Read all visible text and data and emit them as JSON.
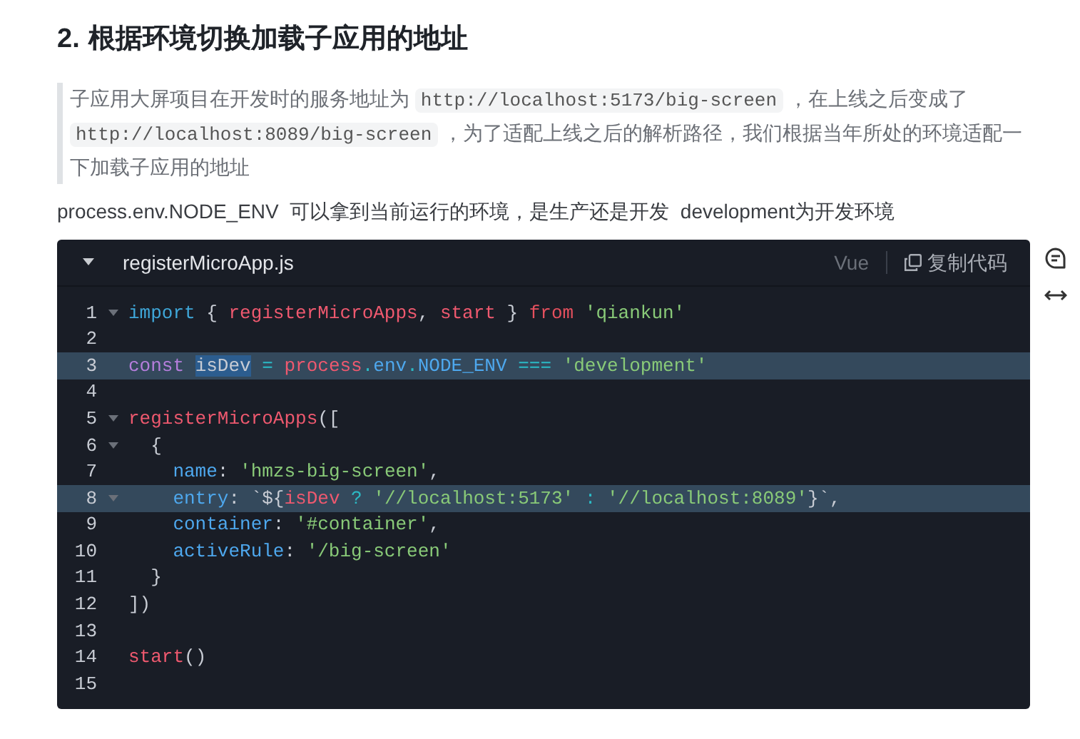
{
  "heading": {
    "number": "2.",
    "text": "根据环境切换加载子应用的地址"
  },
  "quote": {
    "segments": [
      {
        "kind": "text",
        "text": "子应用大屏项目在开发时的服务地址为 "
      },
      {
        "kind": "code",
        "text": "http://localhost:5173/big-screen"
      },
      {
        "kind": "text",
        "text": " ，在上线之后变成了 "
      },
      {
        "kind": "code",
        "text": "http://localhost:8089/big-screen"
      },
      {
        "kind": "text",
        "text": " ，为了适配上线之后的解析路径，我们根据当年所处的环境适配一下加载子应用的地址"
      }
    ]
  },
  "paragraph": "process.env.NODE_ENV  可以拿到当前运行的环境，是生产还是开发  development为开发环境",
  "code_block": {
    "filename": "registerMicroApp.js",
    "expanded": true,
    "language": "Vue",
    "copy_label": "复制代码",
    "lines": [
      {
        "number": "1",
        "foldable": true,
        "highlighted": false,
        "tokens": [
          {
            "kind": "kw",
            "text": "import"
          },
          {
            "kind": "plain",
            "text": " { "
          },
          {
            "kind": "fn",
            "text": "registerMicroApps"
          },
          {
            "kind": "plain",
            "text": ", "
          },
          {
            "kind": "fn",
            "text": "start"
          },
          {
            "kind": "plain",
            "text": " } "
          },
          {
            "kind": "from",
            "text": "from"
          },
          {
            "kind": "str",
            "text": " 'qiankun'"
          }
        ]
      },
      {
        "number": "2",
        "foldable": false,
        "highlighted": false
      },
      {
        "number": "3",
        "foldable": false,
        "highlighted": true,
        "tokens": [
          {
            "kind": "decl",
            "text": "const "
          },
          {
            "kind": "plain",
            "text": "isDev",
            "selected": true
          },
          {
            "kind": "op",
            "text": " = "
          },
          {
            "kind": "fn",
            "text": "process"
          },
          {
            "kind": "op",
            "text": "."
          },
          {
            "kind": "prop",
            "text": "env"
          },
          {
            "kind": "op",
            "text": "."
          },
          {
            "kind": "prop",
            "text": "NODE_ENV"
          },
          {
            "kind": "op",
            "text": " === "
          },
          {
            "kind": "str",
            "text": "'development'"
          }
        ]
      },
      {
        "number": "4",
        "foldable": false,
        "highlighted": false
      },
      {
        "number": "5",
        "foldable": true,
        "highlighted": false,
        "tokens": [
          {
            "kind": "fn",
            "text": "registerMicroApps"
          },
          {
            "kind": "plain",
            "text": "(["
          }
        ]
      },
      {
        "number": "6",
        "foldable": true,
        "highlighted": false,
        "tokens": [
          {
            "kind": "plain",
            "text": "  {"
          }
        ]
      },
      {
        "number": "7",
        "foldable": false,
        "highlighted": false,
        "tokens": [
          {
            "kind": "prop",
            "text": "    name"
          },
          {
            "kind": "plain",
            "text": ": "
          },
          {
            "kind": "str",
            "text": "'hmzs-big-screen'"
          },
          {
            "kind": "plain",
            "text": ","
          }
        ]
      },
      {
        "number": "8",
        "foldable": true,
        "highlighted": true,
        "tokens": [
          {
            "kind": "prop",
            "text": "    entry"
          },
          {
            "kind": "plain",
            "text": ": `${"
          },
          {
            "kind": "fn",
            "text": "isDev"
          },
          {
            "kind": "op",
            "text": " ? "
          },
          {
            "kind": "str",
            "text": "'//localhost:5173'"
          },
          {
            "kind": "op",
            "text": " : "
          },
          {
            "kind": "str",
            "text": "'//localhost:8089'"
          },
          {
            "kind": "plain",
            "text": "}`,"
          }
        ]
      },
      {
        "number": "9",
        "foldable": false,
        "highlighted": false,
        "tokens": [
          {
            "kind": "prop",
            "text": "    container"
          },
          {
            "kind": "plain",
            "text": ": "
          },
          {
            "kind": "str",
            "text": "'#container'"
          },
          {
            "kind": "plain",
            "text": ","
          }
        ]
      },
      {
        "number": "10",
        "foldable": false,
        "highlighted": false,
        "tokens": [
          {
            "kind": "prop",
            "text": "    activeRule"
          },
          {
            "kind": "plain",
            "text": ": "
          },
          {
            "kind": "str",
            "text": "'/big-screen'"
          }
        ]
      },
      {
        "number": "11",
        "foldable": false,
        "highlighted": false,
        "tokens": [
          {
            "kind": "plain",
            "text": "  }"
          }
        ]
      },
      {
        "number": "12",
        "foldable": false,
        "highlighted": false,
        "tokens": [
          {
            "kind": "plain",
            "text": "])"
          }
        ]
      },
      {
        "number": "13",
        "foldable": false,
        "highlighted": false
      },
      {
        "number": "14",
        "foldable": false,
        "highlighted": false,
        "tokens": [
          {
            "kind": "fn",
            "text": "start"
          },
          {
            "kind": "plain",
            "text": "()"
          }
        ]
      },
      {
        "number": "15",
        "foldable": false,
        "highlighted": false
      }
    ]
  }
}
